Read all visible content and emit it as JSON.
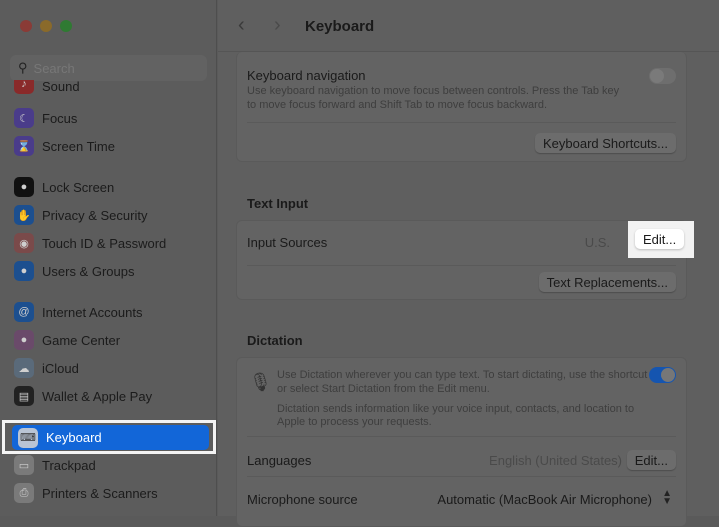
{
  "window": {
    "title": "Keyboard"
  },
  "sidebar": {
    "search_placeholder": "Search",
    "items": [
      {
        "label": "Sound",
        "icon": "speaker-icon",
        "color": "#8a2a2a"
      },
      {
        "label": "Focus",
        "icon": "moon-icon",
        "color": "#4a3c8a"
      },
      {
        "label": "Screen Time",
        "icon": "hourglass-icon",
        "color": "#4a3c8a"
      },
      {
        "label": "Lock Screen",
        "icon": "lock-icon",
        "color": "#111111"
      },
      {
        "label": "Privacy & Security",
        "icon": "hand-icon",
        "color": "#1c4f8f"
      },
      {
        "label": "Touch ID & Password",
        "icon": "fingerprint-icon",
        "color": "#7a4a4a"
      },
      {
        "label": "Users & Groups",
        "icon": "users-icon",
        "color": "#1c4f8f"
      },
      {
        "label": "Internet Accounts",
        "icon": "at-icon",
        "color": "#1c4f8f"
      },
      {
        "label": "Game Center",
        "icon": "game-center-icon",
        "color": "#6a4a6a"
      },
      {
        "label": "iCloud",
        "icon": "cloud-icon",
        "color": "#5a6a7a"
      },
      {
        "label": "Wallet & Apple Pay",
        "icon": "wallet-icon",
        "color": "#222222"
      },
      {
        "label": "Keyboard",
        "icon": "keyboard-icon",
        "color": "#8a8a8a",
        "selected": true
      },
      {
        "label": "Trackpad",
        "icon": "trackpad-icon",
        "color": "#7a7a7a"
      },
      {
        "label": "Printers & Scanners",
        "icon": "printer-icon",
        "color": "#7a7a7a"
      }
    ]
  },
  "main": {
    "keyboard_navigation": {
      "label": "Keyboard navigation",
      "description_1": "Use keyboard navigation to move focus between controls. Press the Tab key",
      "description_2": "to move focus forward and Shift Tab to move focus backward.",
      "enabled": false
    },
    "keyboard_shortcuts_button": "Keyboard Shortcuts...",
    "text_input": {
      "heading": "Text Input",
      "input_sources_label": "Input Sources",
      "input_sources_value": "U.S.",
      "edit_button": "Edit...",
      "text_replacements_button": "Text Replacements..."
    },
    "dictation": {
      "heading": "Dictation",
      "desc_1": "Use Dictation wherever you can type text. To start dictating, use the shortcut",
      "desc_2": "or select Start Dictation from the Edit menu.",
      "privacy_1": "Dictation sends information like your voice input, contacts, and location to",
      "privacy_2": "Apple to process your requests.",
      "enabled": true,
      "languages_label": "Languages",
      "languages_value": "English (United States)",
      "languages_edit": "Edit...",
      "mic_label": "Microphone source",
      "mic_value": "Automatic (MacBook Air Microphone)"
    }
  },
  "colors": {
    "accent": "#1266d8",
    "highlight_frame": "#f4f4f4"
  }
}
